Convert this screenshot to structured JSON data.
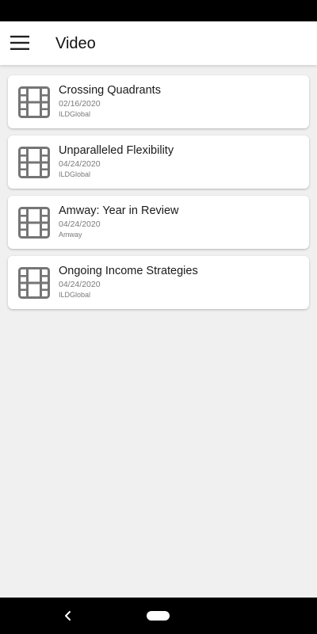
{
  "app_bar": {
    "title": "Video",
    "menu_icon": "hamburger-menu-icon"
  },
  "videos": [
    {
      "title": "Crossing Quadrants",
      "date": "02/16/2020",
      "source": "ILDGlobal",
      "icon": "film-icon"
    },
    {
      "title": "Unparalleled Flexibility",
      "date": "04/24/2020",
      "source": "ILDGlobal",
      "icon": "film-icon"
    },
    {
      "title": "Amway: Year in Review",
      "date": "04/24/2020",
      "source": "Amway",
      "icon": "film-icon"
    },
    {
      "title": "Ongoing Income Strategies",
      "date": "04/24/2020",
      "source": "ILDGlobal",
      "icon": "film-icon"
    }
  ],
  "nav_bar": {
    "back_icon": "back-chevron-icon",
    "home_icon": "home-pill-icon"
  },
  "colors": {
    "app_bar_bg": "#ffffff",
    "content_bg": "#f0f0f0",
    "card_bg": "#ffffff",
    "icon_gray": "#757575",
    "system_bar": "#000000"
  }
}
